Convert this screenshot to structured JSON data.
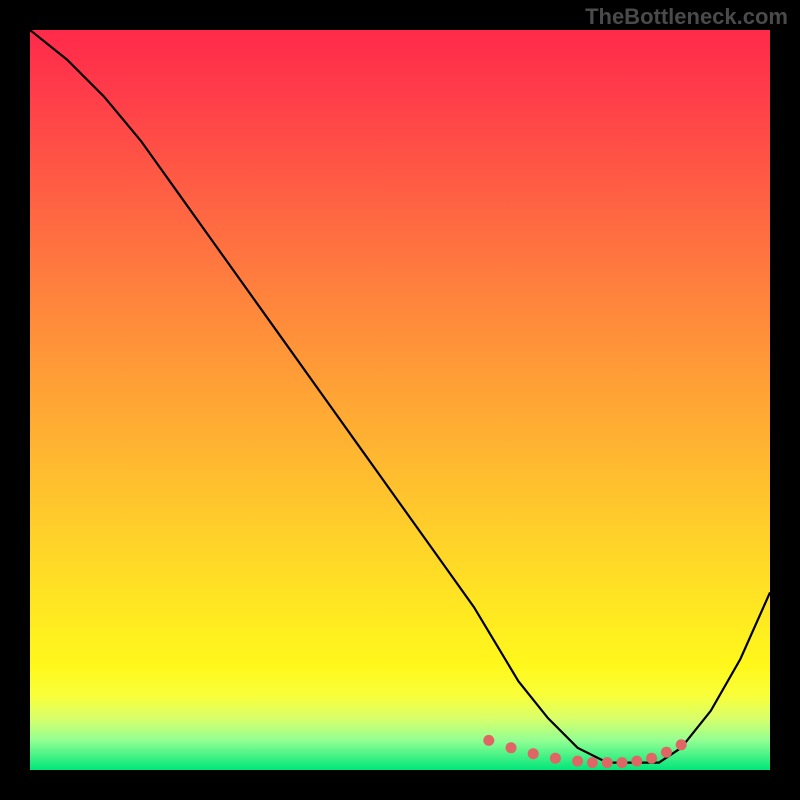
{
  "watermark": "TheBottleneck.com",
  "chart_data": {
    "type": "line",
    "title": "",
    "xlabel": "",
    "ylabel": "",
    "xlim": [
      0,
      100
    ],
    "ylim": [
      0,
      100
    ],
    "grid": false,
    "series": [
      {
        "name": "main-curve",
        "color": "#000000",
        "x": [
          0,
          5,
          10,
          15,
          20,
          25,
          30,
          35,
          40,
          45,
          50,
          55,
          60,
          63,
          66,
          70,
          74,
          78,
          82,
          85,
          88,
          92,
          96,
          100
        ],
        "y": [
          100,
          96,
          91,
          85,
          78,
          71,
          64,
          57,
          50,
          43,
          36,
          29,
          22,
          17,
          12,
          7,
          3,
          1,
          1,
          1,
          3,
          8,
          15,
          24
        ]
      },
      {
        "name": "highlight-dots",
        "color": "#e06666",
        "x": [
          62,
          65,
          68,
          71,
          74,
          76,
          78,
          80,
          82,
          84,
          86,
          88
        ],
        "y": [
          4.0,
          3.0,
          2.2,
          1.6,
          1.2,
          1.0,
          1.0,
          1.0,
          1.2,
          1.6,
          2.4,
          3.4
        ]
      }
    ],
    "background_gradient": {
      "stops": [
        {
          "pos": 0.0,
          "color": "#ff2a4a"
        },
        {
          "pos": 0.3,
          "color": "#ff7440"
        },
        {
          "pos": 0.55,
          "color": "#ffb132"
        },
        {
          "pos": 0.78,
          "color": "#ffe722"
        },
        {
          "pos": 0.93,
          "color": "#d9ff6a"
        },
        {
          "pos": 1.0,
          "color": "#00e67a"
        }
      ]
    }
  }
}
